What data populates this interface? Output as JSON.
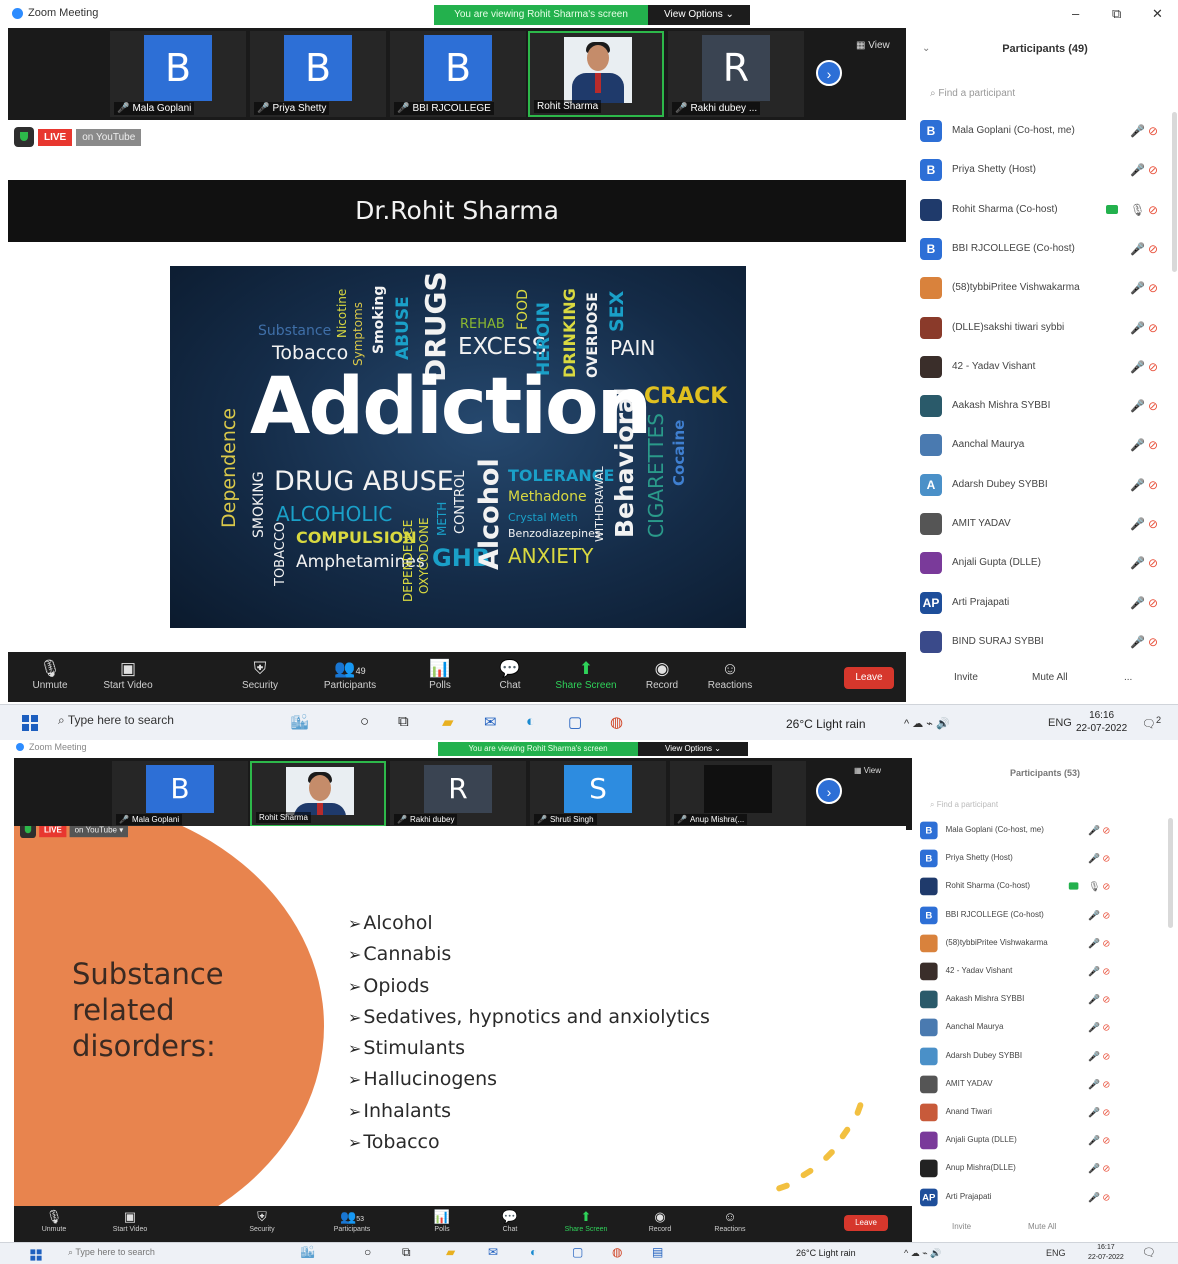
{
  "shot1": {
    "app_title": "Zoom Meeting",
    "viewing_banner": "You are viewing Rohit Sharma's screen",
    "view_options": "View Options ⌄",
    "window_controls": [
      "–",
      "⧉",
      "✕"
    ],
    "view_button": "View",
    "tiles": [
      {
        "letter": "B",
        "name": "Mala Goplani",
        "color": "#2d6fd6",
        "muted": true
      },
      {
        "letter": "B",
        "name": "Priya Shetty",
        "color": "#2d6fd6",
        "muted": true
      },
      {
        "letter": "B",
        "name": "BBI RJCOLLEGE",
        "color": "#2d6fd6",
        "muted": true
      },
      {
        "letter": "",
        "name": "Rohit Sharma",
        "color": "#e9eef2",
        "muted": false
      },
      {
        "letter": "R",
        "name": "Rakhi dubey ...",
        "color": "#3a4452",
        "muted": true
      }
    ],
    "live_label": "LIVE",
    "youtube_label": "on YouTube",
    "speaker_banner": "Dr.Rohit Sharma",
    "wordcloud": {
      "title_word": "Addiction",
      "words": [
        "Substance",
        "Tobacco",
        "Symptoms",
        "Nicotine",
        "Smoking",
        "ABUSE",
        "DRUGS",
        "REHAB",
        "EXCESS",
        "FOOD",
        "HEROIN",
        "DRINKING",
        "OVERDOSE",
        "SEX",
        "PAIN",
        "CRACK",
        "Behavioral",
        "CIGARETTES",
        "Cocaine",
        "Dependence",
        "SMOKING",
        "DRUG ABUSE",
        "ALCOHOLIC",
        "COMPULSION",
        "TOBACCO",
        "Amphetamines",
        "DEPENDENCE",
        "OXYCODONE",
        "METH",
        "CONTROL",
        "GHB",
        "Alcohol",
        "TOLERANCE",
        "Methadone",
        "Crystal Meth",
        "Benzodiazepines",
        "ANXIETY",
        "WITHDRAWAL"
      ]
    },
    "toolbar": {
      "unmute": "Unmute",
      "start_video": "Start Video",
      "security": "Security",
      "participants": "Participants",
      "participants_count": "49",
      "polls": "Polls",
      "chat": "Chat",
      "share_screen": "Share Screen",
      "record": "Record",
      "reactions": "Reactions",
      "leave": "Leave"
    },
    "panel": {
      "title": "Participants (49)",
      "search_placeholder": "Find a participant",
      "participants": [
        {
          "avatar": "B",
          "color": "#2d6fd6",
          "name": "Mala Goplani (Co-host, me)"
        },
        {
          "avatar": "B",
          "color": "#2d6fd6",
          "name": "Priya Shetty (Host)"
        },
        {
          "avatar": "",
          "color": "#1f3a6b",
          "name": "Rohit Sharma (Co-host)",
          "video_on": true
        },
        {
          "avatar": "B",
          "color": "#2d6fd6",
          "name": "BBI RJCOLLEGE (Co-host)"
        },
        {
          "avatar": "",
          "color": "#d9823c",
          "name": "(58)tybbiPritee Vishwakarma"
        },
        {
          "avatar": "",
          "color": "#8a3a2a",
          "name": "(DLLE)sakshi tiwari sybbi"
        },
        {
          "avatar": "",
          "color": "#3a2e2a",
          "name": "42 - Yadav Vishant"
        },
        {
          "avatar": "",
          "color": "#2a5a6a",
          "name": "Aakash Mishra SYBBI"
        },
        {
          "avatar": "",
          "color": "#4a7ab0",
          "name": "Aanchal Maurya"
        },
        {
          "avatar": "A",
          "color": "#4a90c8",
          "name": "Adarsh Dubey SYBBI"
        },
        {
          "avatar": "",
          "color": "#555555",
          "name": "AMIT YADAV"
        },
        {
          "avatar": "",
          "color": "#7a3a9a",
          "name": "Anjali Gupta (DLLE)"
        },
        {
          "avatar": "AP",
          "color": "#1e4e9a",
          "name": "Arti Prajapati"
        },
        {
          "avatar": "",
          "color": "#3a4a8a",
          "name": "BIND SURAJ SYBBI"
        }
      ],
      "invite": "Invite",
      "mute_all": "Mute All",
      "more": "..."
    },
    "taskbar": {
      "search_placeholder": "Type here to search",
      "weather": "26°C  Light rain",
      "lang": "ENG",
      "time": "16:16",
      "date": "22-07-2022",
      "notif_count": "2"
    }
  },
  "shot2": {
    "app_title": "Zoom Meeting",
    "viewing_banner": "You are viewing Rohit Sharma's screen",
    "view_options": "View Options ⌄",
    "view_button": "View",
    "tiles": [
      {
        "letter": "B",
        "name": "Mala Goplani",
        "color": "#2d6fd6",
        "muted": true
      },
      {
        "letter": "",
        "name": "Rohit Sharma",
        "color": "#e9eef2",
        "muted": false
      },
      {
        "letter": "R",
        "name": "Rakhi dubey",
        "color": "#3a4452",
        "muted": true
      },
      {
        "letter": "S",
        "name": "Shruti Singh",
        "color": "#2d8ce0",
        "muted": true
      },
      {
        "letter": "",
        "name": "Anup Mishra(...",
        "color": "#101010",
        "muted": true
      }
    ],
    "live_label": "LIVE",
    "youtube_label": "on YouTube ▾",
    "slide": {
      "title_lines": [
        "Substance",
        "related",
        "disorders:"
      ],
      "bullets": [
        "Alcohol",
        "Cannabis",
        "Opiods",
        "Sedatives, hypnotics and anxiolytics",
        "Stimulants",
        "Hallucinogens",
        "Inhalants",
        "Tobacco"
      ]
    },
    "toolbar": {
      "unmute": "Unmute",
      "start_video": "Start Video",
      "security": "Security",
      "participants": "Participants",
      "participants_count": "53",
      "polls": "Polls",
      "chat": "Chat",
      "share_screen": "Share Screen",
      "record": "Record",
      "reactions": "Reactions",
      "leave": "Leave"
    },
    "panel": {
      "title": "Participants (53)",
      "search_placeholder": "Find a participant",
      "participants": [
        {
          "avatar": "B",
          "color": "#2d6fd6",
          "name": "Mala Goplani (Co-host, me)"
        },
        {
          "avatar": "B",
          "color": "#2d6fd6",
          "name": "Priya Shetty (Host)"
        },
        {
          "avatar": "",
          "color": "#1f3a6b",
          "name": "Rohit Sharma (Co-host)",
          "video_on": true
        },
        {
          "avatar": "B",
          "color": "#2d6fd6",
          "name": "BBI RJCOLLEGE (Co-host)"
        },
        {
          "avatar": "",
          "color": "#d9823c",
          "name": "(58)tybbiPritee Vishwakarma"
        },
        {
          "avatar": "",
          "color": "#3a2e2a",
          "name": "42 - Yadav Vishant"
        },
        {
          "avatar": "",
          "color": "#2a5a6a",
          "name": "Aakash Mishra SYBBI"
        },
        {
          "avatar": "",
          "color": "#4a7ab0",
          "name": "Aanchal Maurya"
        },
        {
          "avatar": "",
          "color": "#4a90c8",
          "name": "Adarsh Dubey SYBBI"
        },
        {
          "avatar": "",
          "color": "#555555",
          "name": "AMIT YADAV"
        },
        {
          "avatar": "",
          "color": "#c85a3a",
          "name": "Anand Tiwari"
        },
        {
          "avatar": "",
          "color": "#7a3a9a",
          "name": "Anjali Gupta (DLLE)"
        },
        {
          "avatar": "",
          "color": "#222222",
          "name": "Anup Mishra(DLLE)"
        },
        {
          "avatar": "AP",
          "color": "#1e4e9a",
          "name": "Arti Prajapati"
        }
      ],
      "invite": "Invite",
      "mute_all": "Mute All"
    },
    "taskbar": {
      "search_placeholder": "Type here to search",
      "weather": "26°C  Light rain",
      "lang": "ENG",
      "time": "16:17",
      "date": "22-07-2022"
    }
  }
}
